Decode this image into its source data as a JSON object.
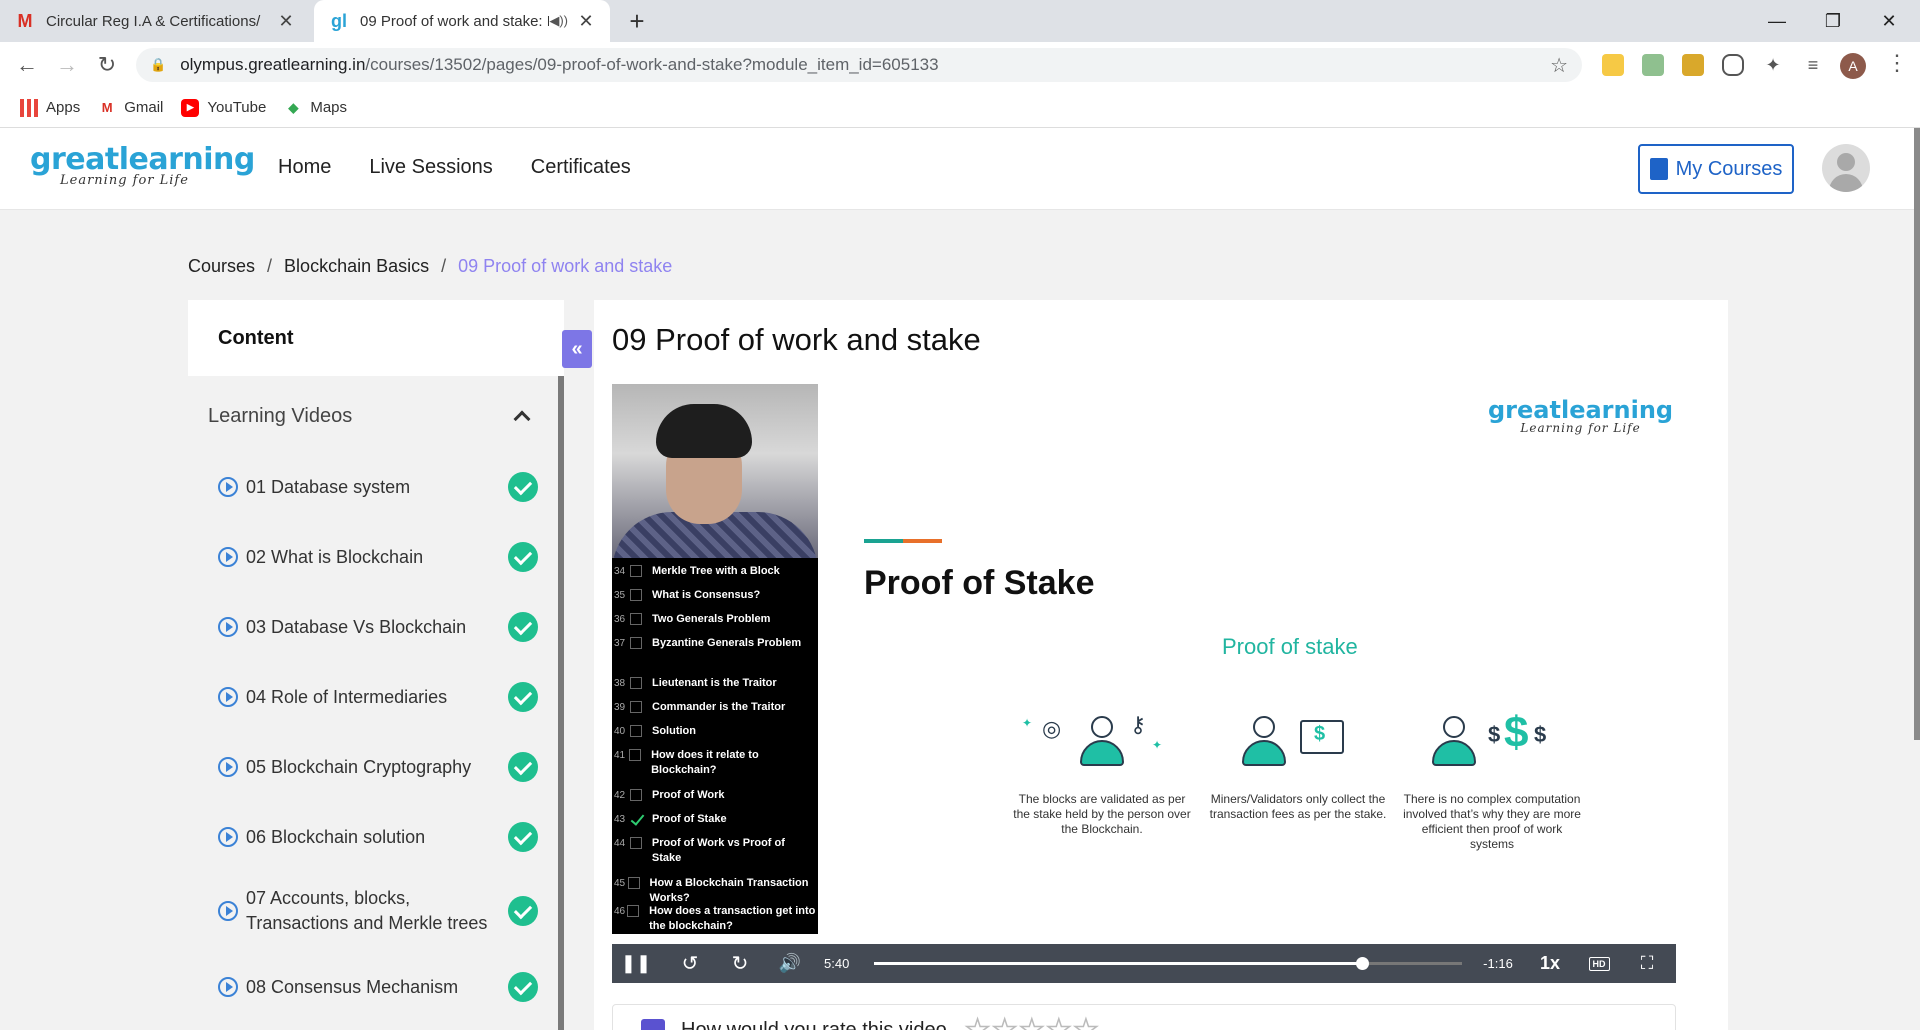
{
  "browser": {
    "tabs": [
      {
        "title": "Circular Reg I.A & Certifications/",
        "favicon": "gmail-icon",
        "active": false
      },
      {
        "title": "09 Proof of work and stake: E",
        "favicon": "greatlearning-icon",
        "active": true
      }
    ],
    "url_host": "olympus.greatlearning.in",
    "url_path": "/courses/13502/pages/09-proof-of-work-and-stake?module_item_id=605133",
    "profile_initial": "A",
    "bookmarks": [
      "Apps",
      "Gmail",
      "YouTube",
      "Maps"
    ]
  },
  "site": {
    "logo_word_a": "great",
    "logo_word_b": "learning",
    "logo_tagline": "Learning for Life",
    "nav": [
      "Home",
      "Live Sessions",
      "Certificates"
    ],
    "my_courses_label": "My Courses",
    "accent_color": "#1e63c7"
  },
  "breadcrumb": {
    "items": [
      "Courses",
      "Blockchain Basics"
    ],
    "current": "09 Proof of work and stake"
  },
  "sidebar": {
    "header": "Content",
    "section_title": "Learning Videos",
    "videos": [
      {
        "label": "01 Database system",
        "completed": true
      },
      {
        "label": "02 What is Blockchain",
        "completed": true
      },
      {
        "label": "03 Database Vs Blockchain",
        "completed": true
      },
      {
        "label": "04 Role of Intermediaries",
        "completed": true
      },
      {
        "label": "05 Blockchain Cryptography",
        "completed": true
      },
      {
        "label": "06 Blockchain solution",
        "completed": true
      },
      {
        "label": "07 Accounts, blocks, Transactions and Merkle trees",
        "completed": true
      },
      {
        "label": "08 Consensus Mechanism",
        "completed": true
      }
    ]
  },
  "main": {
    "title": "09 Proof of work and stake",
    "video": {
      "toc": [
        {
          "num": "34",
          "label": "Merkle Tree with a Block",
          "done": false
        },
        {
          "num": "35",
          "label": "What is Consensus?",
          "done": false
        },
        {
          "num": "36",
          "label": "Two Generals Problem",
          "done": false
        },
        {
          "num": "37",
          "label": "Byzantine Generals Problem",
          "done": false
        },
        {
          "num": "38",
          "label": "Lieutenant is the Traitor",
          "done": false
        },
        {
          "num": "39",
          "label": "Commander is the Traitor",
          "done": false
        },
        {
          "num": "40",
          "label": "Solution",
          "done": false
        },
        {
          "num": "41",
          "label": "How does it relate to Blockchain?",
          "done": false
        },
        {
          "num": "42",
          "label": "Proof of Work",
          "done": false
        },
        {
          "num": "43",
          "label": "Proof of Stake",
          "done": true
        },
        {
          "num": "44",
          "label": "Proof of Work vs Proof of Stake",
          "done": false
        },
        {
          "num": "45",
          "label": "How a Blockchain Transaction Works?",
          "done": false
        },
        {
          "num": "46",
          "label": "How does a transaction get into the blockchain?",
          "done": false
        }
      ],
      "slide_title": "Proof of Stake",
      "slide_subtitle": "Proof of stake",
      "slide_points": [
        "The blocks are validated as per the stake held by the person over the Blockchain.",
        "Miners/Validators only collect the transaction fees as per the stake.",
        "There is no complex computation involved that’s why they are more efficient then proof of work systems"
      ],
      "elapsed": "5:40",
      "remaining": "-1:16",
      "progress_fraction": 0.83,
      "speed": "1x",
      "quality": "HD"
    },
    "rating_prompt": "How would you rate this video"
  }
}
